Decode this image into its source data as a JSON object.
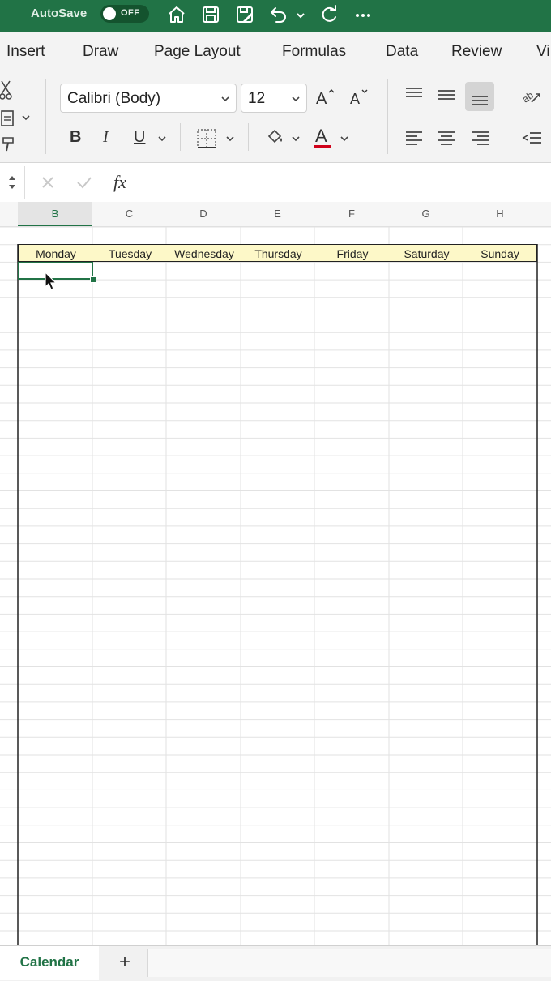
{
  "titlebar": {
    "autosave_label": "AutoSave",
    "autosave_state": "OFF"
  },
  "menu": {
    "tabs": [
      "Insert",
      "Draw",
      "Page Layout",
      "Formulas",
      "Data",
      "Review",
      "Vi"
    ]
  },
  "ribbon": {
    "font_name": "Calibri (Body)",
    "font_size": "12",
    "bold": "B",
    "italic": "I",
    "underline": "U"
  },
  "formula_bar": {
    "fx_label": "fx"
  },
  "sheet": {
    "columns": [
      "B",
      "C",
      "D",
      "E",
      "F",
      "G",
      "H"
    ],
    "selected_column": "B",
    "header_row": [
      "Monday",
      "Tuesday",
      "Wednesday",
      "Thursday",
      "Friday",
      "Saturday",
      "Sunday"
    ],
    "header_fill": "#fdf8c8"
  },
  "tabs": {
    "active_sheet": "Calendar",
    "add_sheet": "+"
  },
  "colors": {
    "accent": "#217346"
  }
}
